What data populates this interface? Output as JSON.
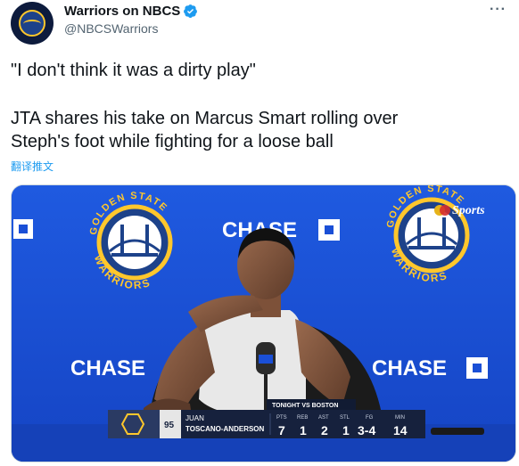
{
  "account": {
    "display_name": "Warriors on NBCS",
    "handle": "@NBCSWarriors",
    "more_label": "···"
  },
  "tweet": {
    "line1": "\"I don't think it was a dirty play\"",
    "line2a": "JTA shares his take on Marcus Smart rolling over",
    "line2b": "Steph's foot while fighting for a loose ball",
    "translate": "翻译推文"
  },
  "video": {
    "sponsor": "CHASE",
    "logo_text_top": "GOLDEN STATE",
    "logo_text_bottom": "WARRIORS",
    "network": "Sports",
    "lower_third": {
      "matchup": "TONIGHT VS BOSTON",
      "jersey": "95",
      "first_name": "JUAN",
      "last_name": "TOSCANO-ANDERSON",
      "stats": [
        {
          "label": "PTS",
          "value": "7"
        },
        {
          "label": "REB",
          "value": "1"
        },
        {
          "label": "AST",
          "value": "2"
        },
        {
          "label": "STL",
          "value": "1"
        },
        {
          "label": "FG",
          "value": "3-4"
        },
        {
          "label": "MIN",
          "value": "14"
        }
      ]
    }
  },
  "colors": {
    "backdrop_blue": "#1a4fd6",
    "warriors_gold": "#ffc72c",
    "link_blue": "#1d9bf0"
  }
}
